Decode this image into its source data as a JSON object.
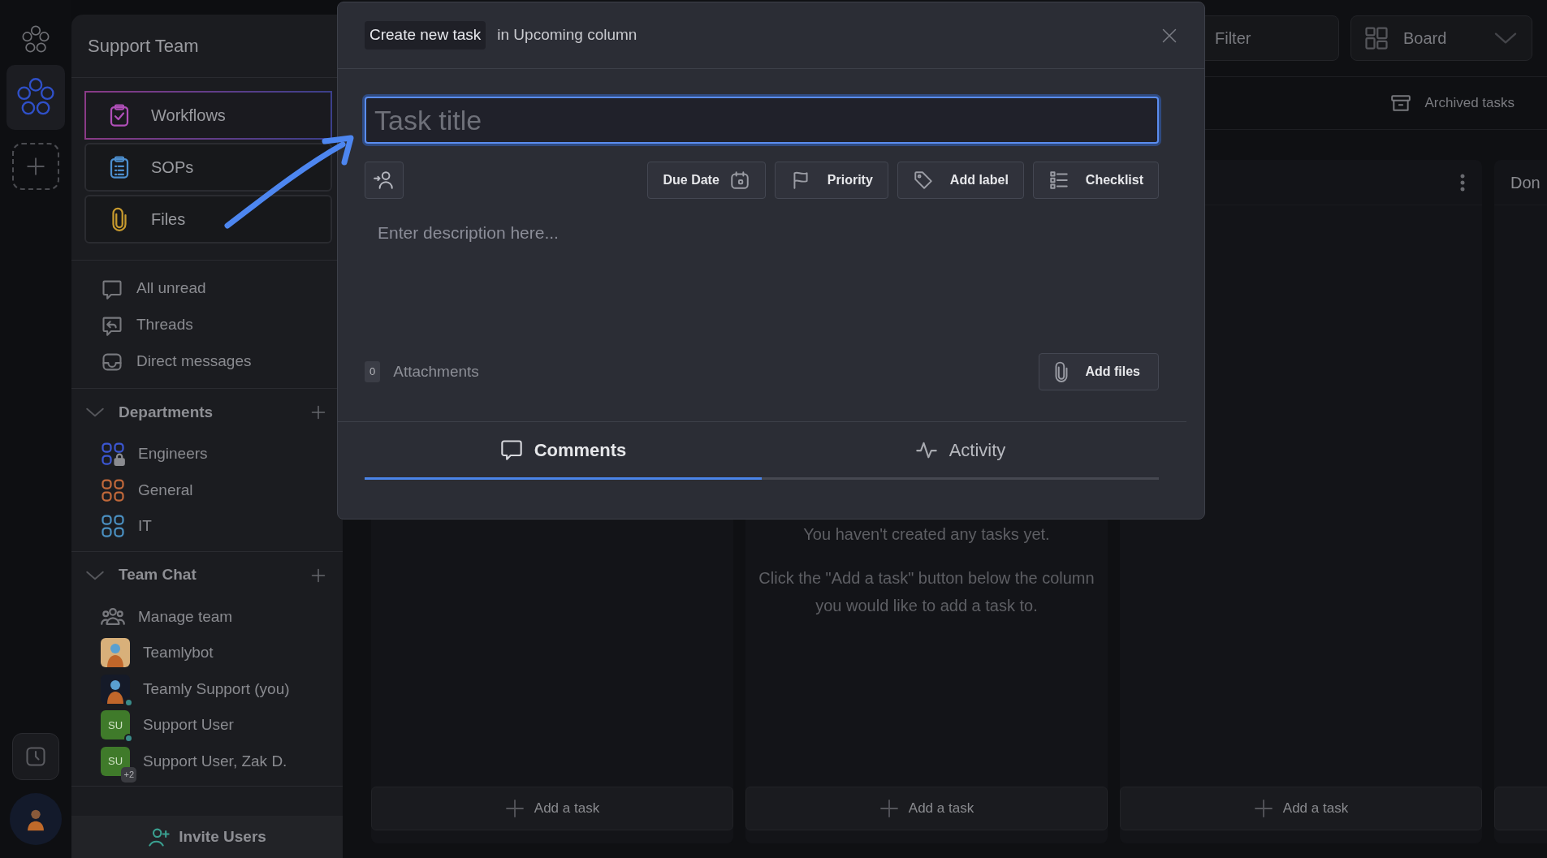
{
  "sidebar": {
    "title": "Support Team",
    "nav_buttons": [
      {
        "label": "Workflows",
        "selected": true
      },
      {
        "label": "SOPs",
        "selected": false
      },
      {
        "label": "Files",
        "selected": false
      }
    ],
    "quick_links": [
      {
        "label": "All unread"
      },
      {
        "label": "Threads"
      },
      {
        "label": "Direct messages"
      }
    ],
    "sections": [
      {
        "title": "Departments",
        "expanded": true,
        "items": [
          {
            "label": "Engineers",
            "kind": "group",
            "color": "#3b56d1",
            "locked": true
          },
          {
            "label": "General",
            "kind": "group",
            "color": "#c0683a",
            "locked": false
          },
          {
            "label": "IT",
            "kind": "group",
            "color": "#4a8fc0",
            "locked": false
          }
        ]
      },
      {
        "title": "Team Chat",
        "expanded": true,
        "items": [
          {
            "label": "Manage team",
            "kind": "team"
          },
          {
            "label": "Teamlybot",
            "kind": "picture-avatar",
            "online": false
          },
          {
            "label": "Teamly Support (you)",
            "kind": "dark-avatar",
            "online": true
          },
          {
            "label": "Support User",
            "kind": "initials",
            "initials": "SU",
            "online": true
          },
          {
            "label": "Support User, Zak D.",
            "kind": "initials",
            "initials": "SU",
            "online": false,
            "extra": "+2"
          }
        ]
      }
    ],
    "invite": "Invite Users"
  },
  "board": {
    "filter": "Filter",
    "view": "Board",
    "archived": "Archived tasks",
    "columns": [
      {
        "add_label": "Add a task"
      },
      {
        "empty_message": [
          "You haven't created any tasks yet.",
          "Click the \"Add a task\" button below the column",
          "you would like to add a task to."
        ],
        "add_label": "Add a task"
      },
      {
        "menu": true,
        "add_label": "Add a task"
      },
      {
        "title": "Don"
      }
    ]
  },
  "modal": {
    "badge": "Create new task",
    "context": "in Upcoming column",
    "title_field": {
      "placeholder": "Task title"
    },
    "toolbar": [
      {
        "label": "Due Date"
      },
      {
        "label": "Priority"
      },
      {
        "label": "Add label"
      },
      {
        "label": "Checklist"
      }
    ],
    "description": {
      "placeholder": "Enter description here..."
    },
    "attachments": {
      "count": "0",
      "label": "Attachments",
      "button": "Add files"
    },
    "tabs": [
      {
        "label": "Comments",
        "selected": true
      },
      {
        "label": "Activity",
        "selected": false
      }
    ]
  }
}
